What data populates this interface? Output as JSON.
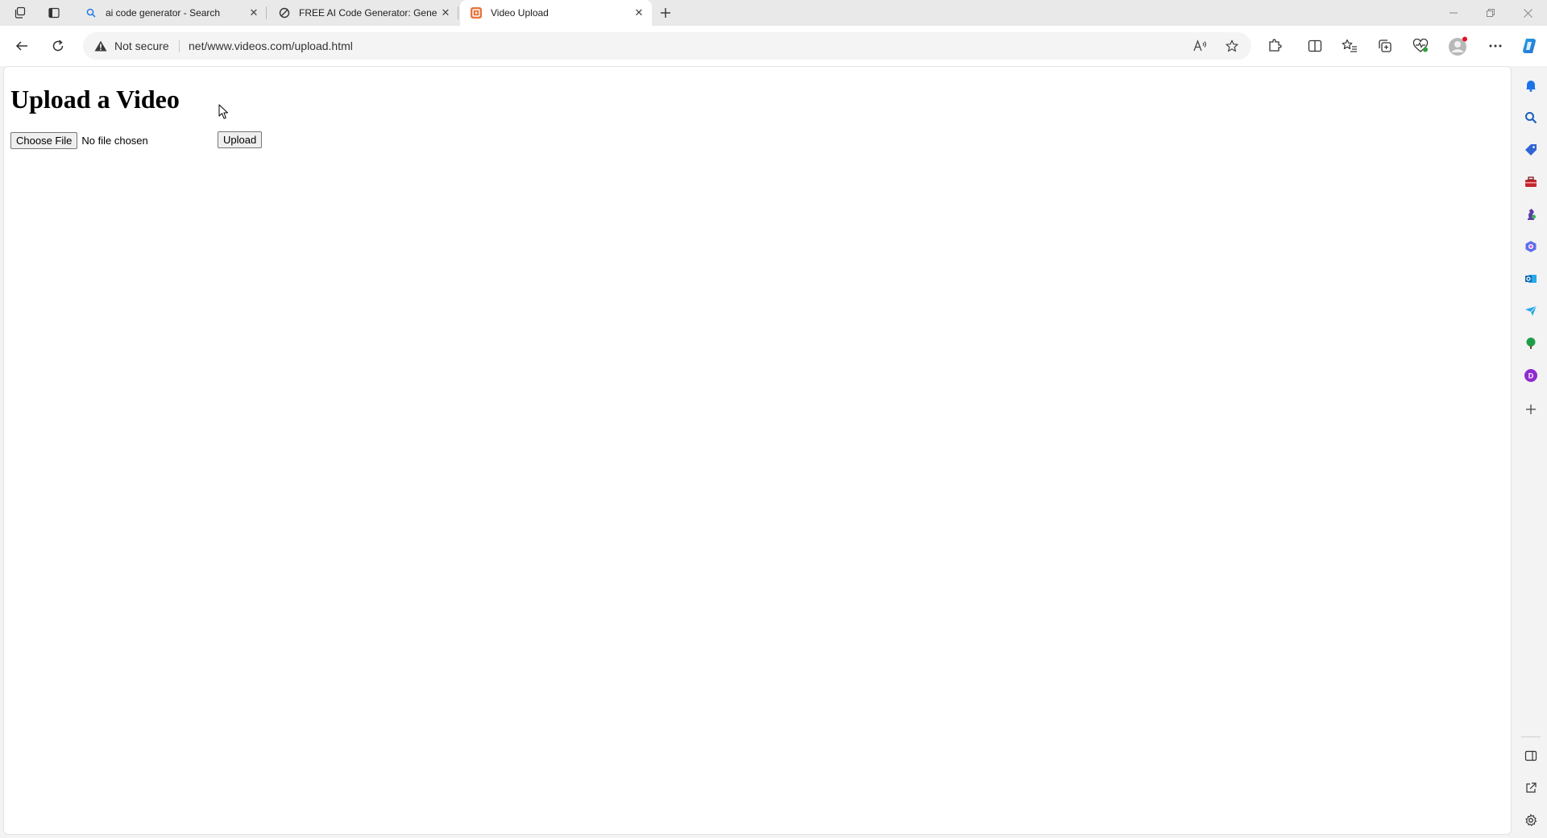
{
  "browser": {
    "tabs": [
      {
        "title": "ai code generator - Search",
        "favicon": "search-icon",
        "active": false
      },
      {
        "title": "FREE AI Code Generator: Genera",
        "favicon": "code-generator-icon",
        "active": false
      },
      {
        "title": "Video Upload",
        "favicon": "video-upload-icon",
        "active": true
      }
    ],
    "security_label": "Not secure",
    "url": "net/www.videos.com/upload.html",
    "profile_notification": true,
    "colors": {
      "accent": "#1a73e8",
      "copilot": "#1ba1e2",
      "warning_dot": "#e81123",
      "upload_favicon": "#e8733a"
    }
  },
  "page": {
    "heading": "Upload a Video",
    "file_input": {
      "button_label": "Choose File",
      "status": "No file chosen"
    },
    "upload_button_label": "Upload"
  },
  "sidebar": {
    "items": [
      "bell-icon",
      "search-icon",
      "shopping-tag-icon",
      "toolbox-icon",
      "chess-icon",
      "office-icon",
      "outlook-icon",
      "send-icon",
      "tree-icon",
      "designer-icon",
      "add-icon"
    ],
    "bottom_items": [
      "split-screen-icon",
      "external-link-icon",
      "settings-icon"
    ]
  }
}
